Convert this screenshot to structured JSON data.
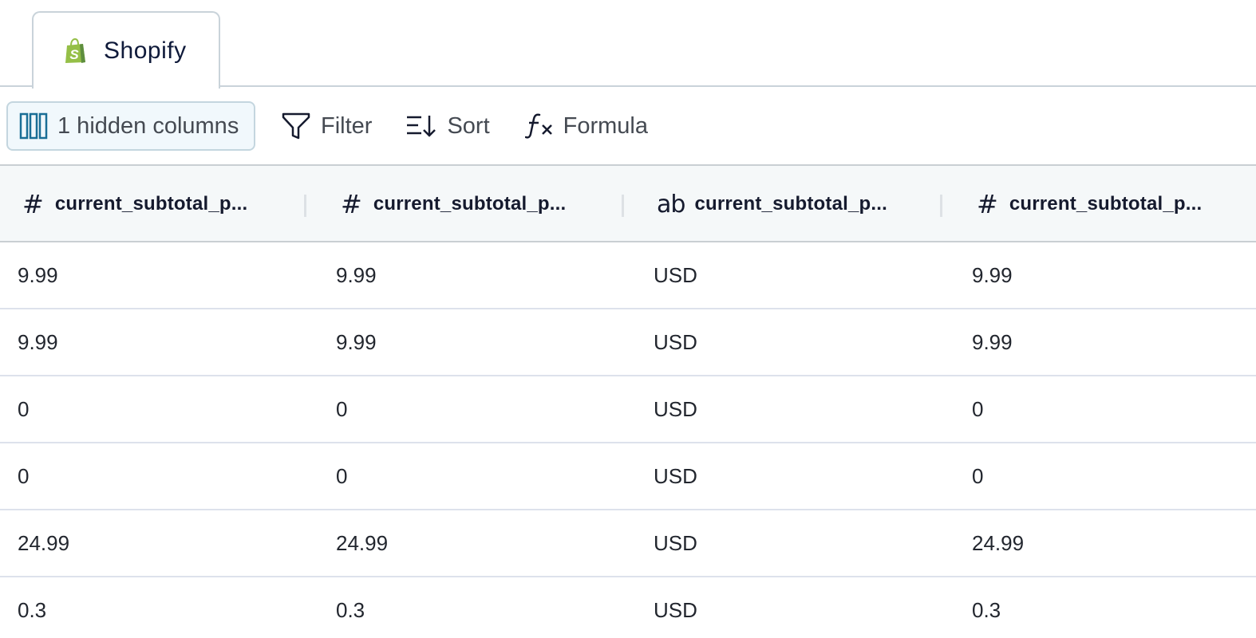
{
  "tabs": [
    {
      "label": "Shopify",
      "icon": "shopify-bag-icon",
      "active": true
    }
  ],
  "toolbar": {
    "hidden_columns_label": "1 hidden columns",
    "filter_label": "Filter",
    "sort_label": "Sort",
    "formula_label": "Formula"
  },
  "colors": {
    "accent": "#1a6e96",
    "hidden_button_bg": "#f1f8fc",
    "header_bg": "#f5f8f9",
    "shopify_green": "#95bf47"
  },
  "table": {
    "columns": [
      {
        "type": "number",
        "type_icon": "#",
        "label": "current_subtotal_p..."
      },
      {
        "type": "number",
        "type_icon": "#",
        "label": "current_subtotal_p..."
      },
      {
        "type": "text",
        "type_icon": "ab",
        "label": "current_subtotal_p..."
      },
      {
        "type": "number",
        "type_icon": "#",
        "label": "current_subtotal_p..."
      }
    ],
    "rows": [
      [
        "9.99",
        "9.99",
        "USD",
        "9.99"
      ],
      [
        "9.99",
        "9.99",
        "USD",
        "9.99"
      ],
      [
        "0",
        "0",
        "USD",
        "0"
      ],
      [
        "0",
        "0",
        "USD",
        "0"
      ],
      [
        "24.99",
        "24.99",
        "USD",
        "24.99"
      ],
      [
        "0.3",
        "0.3",
        "USD",
        "0.3"
      ]
    ]
  }
}
